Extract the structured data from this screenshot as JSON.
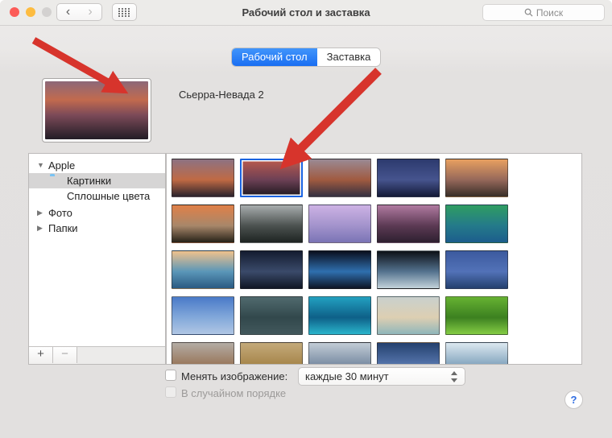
{
  "titlebar": {
    "title": "Рабочий стол и заставка",
    "search_placeholder": "Поиск",
    "back_glyph": "‹",
    "forward_glyph": "›"
  },
  "colors": {
    "traffic_close": "#fc5b57",
    "traffic_min": "#fdbc40",
    "traffic_zoom_disabled": "#d3d1d0",
    "accent_blue": "#1a6ef2",
    "annotation_arrow": "#d7342c",
    "selection_border": "#1a63e0"
  },
  "tabs": [
    {
      "label": "Рабочий стол",
      "selected": true
    },
    {
      "label": "Заставка",
      "selected": false
    }
  ],
  "preview": {
    "name": "Сьерра-Невада 2",
    "colors": [
      "#8d6878",
      "#c26a4e",
      "#7c4a58",
      "#221d26"
    ]
  },
  "sidebar": {
    "items": [
      {
        "label": "Apple",
        "type": "group",
        "expanded": true
      },
      {
        "label": "Картинки",
        "icon": "folder-icon",
        "selected": true
      },
      {
        "label": "Сплошные цвета",
        "icon": "color-wheel-icon",
        "selected": false
      },
      {
        "label": "Фото",
        "type": "group",
        "expanded": false
      },
      {
        "label": "Папки",
        "type": "group",
        "expanded": false
      }
    ],
    "add_label": "+",
    "remove_label": "−"
  },
  "grid": {
    "thumbs": [
      {
        "id": "sierra-dark",
        "selected": false,
        "colors": [
          "#8d7282",
          "#c06a44",
          "#2a222c"
        ]
      },
      {
        "id": "sierra-2",
        "selected": true,
        "colors": [
          "#b85a4e",
          "#6d4055",
          "#201a20"
        ]
      },
      {
        "id": "yosemite-sunset",
        "selected": false,
        "colors": [
          "#9a8a94",
          "#a05a40",
          "#343040"
        ]
      },
      {
        "id": "night-mountain",
        "selected": false,
        "colors": [
          "#2c3a6e",
          "#46548e",
          "#141a38"
        ]
      },
      {
        "id": "half-dome-glow",
        "selected": false,
        "colors": [
          "#e8a060",
          "#96685a",
          "#382e28"
        ]
      },
      {
        "id": "el-capitan",
        "selected": false,
        "colors": [
          "#e08048",
          "#a8876a",
          "#262218"
        ]
      },
      {
        "id": "yosemite-mono",
        "selected": false,
        "colors": [
          "#a8adae",
          "#4c5250",
          "#1e2422"
        ]
      },
      {
        "id": "half-dome-purple",
        "selected": false,
        "colors": [
          "#cdb2e4",
          "#a393cc",
          "#7a74b5"
        ]
      },
      {
        "id": "twilight-lake",
        "selected": false,
        "colors": [
          "#b07aa0",
          "#5c3a54",
          "#2e2030"
        ]
      },
      {
        "id": "green-wave",
        "selected": false,
        "colors": [
          "#2f9d62",
          "#247a8a",
          "#1c5d8c"
        ]
      },
      {
        "id": "sunset-wave",
        "selected": false,
        "colors": [
          "#f0c28c",
          "#5a96b8",
          "#2a5a82"
        ]
      },
      {
        "id": "galaxy",
        "selected": false,
        "colors": [
          "#141c30",
          "#3a4a6a",
          "#101624"
        ]
      },
      {
        "id": "earth-horizon",
        "selected": false,
        "colors": [
          "#0a0f1e",
          "#2f6fae",
          "#0e1626"
        ]
      },
      {
        "id": "earth-surface",
        "selected": false,
        "colors": [
          "#0c1016",
          "#54728e",
          "#c2d2da"
        ]
      },
      {
        "id": "milky-way",
        "selected": false,
        "colors": [
          "#3c5a9e",
          "#5272b8",
          "#24406e"
        ]
      },
      {
        "id": "moon-sky",
        "selected": false,
        "colors": [
          "#4a7ac8",
          "#82a8da",
          "#b0c6e4"
        ]
      },
      {
        "id": "storm-clouds",
        "selected": false,
        "colors": [
          "#506a6e",
          "#32484c",
          "#42585c"
        ]
      },
      {
        "id": "turquoise-water",
        "selected": false,
        "colors": [
          "#22a0c0",
          "#0e6088",
          "#2ab4cc"
        ]
      },
      {
        "id": "beach-aerial",
        "selected": false,
        "colors": [
          "#c9d0cd",
          "#ddcfb2",
          "#8fb6ba"
        ]
      },
      {
        "id": "green-fields",
        "selected": false,
        "colors": [
          "#66b232",
          "#3c8020",
          "#84cc44"
        ]
      },
      {
        "id": "autumn-fog",
        "selected": false,
        "colors": [
          "#b4aca4",
          "#9a7a60",
          "#7c6e66"
        ]
      },
      {
        "id": "golden-mist",
        "selected": false,
        "colors": [
          "#c4aa7a",
          "#a8884e",
          "#6e5a40"
        ]
      },
      {
        "id": "misty-ridges",
        "selected": false,
        "colors": [
          "#c2ccd6",
          "#7e90a6",
          "#343c4c"
        ]
      },
      {
        "id": "dusk-clouds",
        "selected": false,
        "colors": [
          "#24406e",
          "#5272a8",
          "#b28a62"
        ]
      },
      {
        "id": "ice-floe",
        "selected": false,
        "colors": [
          "#dce8f0",
          "#8aaac2",
          "#4a6a8a"
        ]
      },
      {
        "id": "snow-dunes",
        "selected": false,
        "colors": [
          "#f2f4f8",
          "#d8dee8",
          "#bcc6d6"
        ]
      },
      {
        "id": "frozen-forest",
        "selected": false,
        "colors": [
          "#88b2c2",
          "#5a8aa0",
          "#3e6a84"
        ]
      },
      {
        "id": "blue-crystal",
        "selected": false,
        "colors": [
          "#4250a0",
          "#2c3880",
          "#1e2860"
        ]
      },
      {
        "id": "misty-lake",
        "selected": false,
        "colors": [
          "#dcdfe0",
          "#aab0b2",
          "#8c9294"
        ]
      },
      {
        "id": "violet-mist",
        "selected": false,
        "colors": [
          "#cc8ede",
          "#a874c4",
          "#8858a8"
        ]
      }
    ]
  },
  "footer": {
    "change_label": "Менять изображение:",
    "change_checked": false,
    "interval_value": "каждые 30 минут",
    "random_label": "В случайном порядке",
    "random_checked": false,
    "help_label": "?"
  }
}
